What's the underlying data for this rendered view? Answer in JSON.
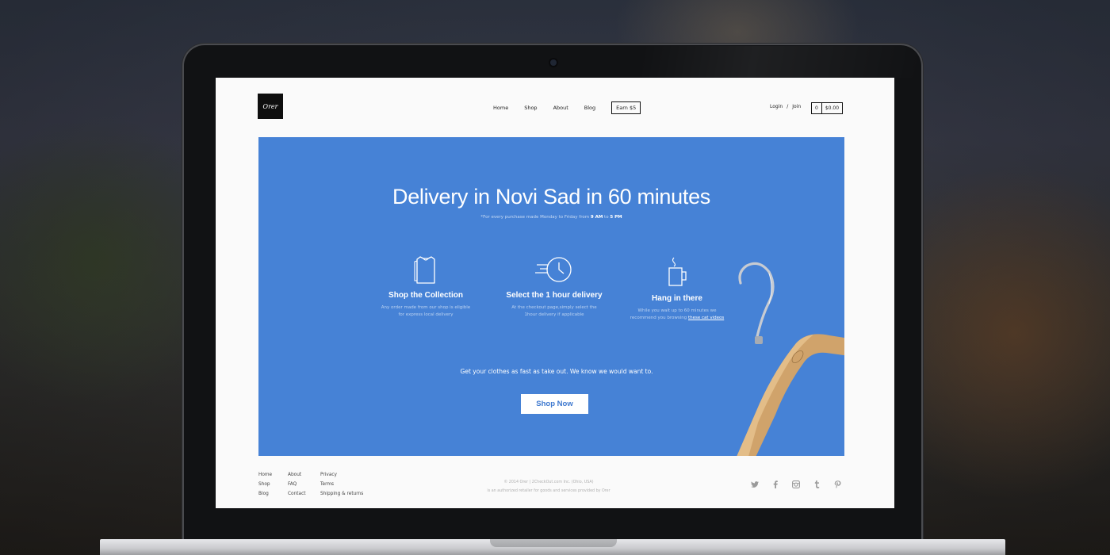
{
  "header": {
    "logo_text": "Orer",
    "nav": [
      "Home",
      "Shop",
      "About",
      "Blog"
    ],
    "earn_label": "Earn $5",
    "login_label": "Login",
    "separator": "/",
    "join_label": "Join",
    "cart_count": "0",
    "cart_total": "$0.00"
  },
  "hero": {
    "title": "Delivery in Novi Sad in 60 minutes",
    "subtitle_prefix": "*For every purchase made Monday to Friday from ",
    "subtitle_from": "9 AM",
    "subtitle_mid": " to ",
    "subtitle_to": "5 PM",
    "features": [
      {
        "icon": "shirts-icon",
        "title": "Shop the Collection",
        "desc": "Any order made from our shop is eligible for express local delivery"
      },
      {
        "icon": "clock-icon",
        "title": "Select the 1 hour delivery",
        "desc": "At the checkout page,simply select the 1hour delivery if applicable"
      },
      {
        "icon": "mug-icon",
        "title": "Hang in there",
        "desc_prefix": "While you wait up to 60 minutes we recommend you browsing ",
        "desc_link": "these cat videos"
      }
    ],
    "tagline": "Get your clothes as fast as take out. We know we would want to.",
    "cta": "Shop Now"
  },
  "footer": {
    "col1": [
      "Home",
      "Shop",
      "Blog"
    ],
    "col2": [
      "About",
      "FAQ",
      "Contact"
    ],
    "col3": [
      "Privacy",
      "Terms",
      "Shipping & returns"
    ],
    "copyright_line1": "© 2014 Orer | 2CheckOut.com Inc. (Ohio, USA)",
    "copyright_line2": "is an authorized retailer for goods and services provided by Orer",
    "social": [
      "twitter-icon",
      "facebook-icon",
      "instagram-icon",
      "tumblr-icon",
      "pinterest-icon"
    ]
  },
  "colors": {
    "hero_blue": "#4682d6",
    "screen_bg": "#fafafa",
    "text_dark": "#222222"
  }
}
